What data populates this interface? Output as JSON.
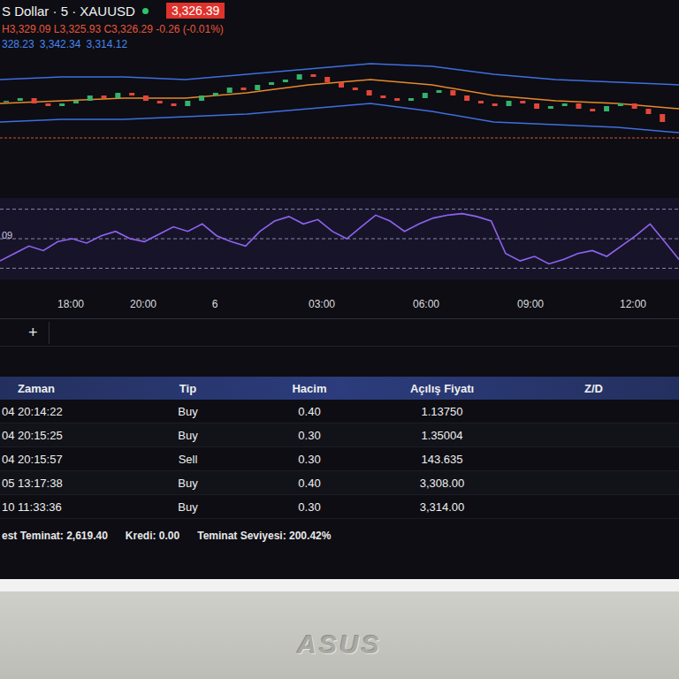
{
  "chart": {
    "symbol": "S Dollar · 5 · XAUUSD",
    "live": true,
    "price": "3,326.39",
    "ohlc": "H3,329.09 L3,325.93 C3,326.29 -0.26 (-0.01%)",
    "bands_values": [
      "328.23",
      "3,342.34",
      "3,314.12"
    ],
    "closes": [
      3328,
      3329,
      3327,
      3326,
      3327,
      3328,
      3330,
      3329,
      3331,
      3330,
      3328,
      3327,
      3326,
      3328,
      3330,
      3331,
      3333,
      3332,
      3334,
      3335,
      3336,
      3338,
      3337,
      3335,
      3333,
      3332,
      3330,
      3329,
      3328,
      3329,
      3331,
      3332,
      3330,
      3328,
      3327,
      3326,
      3328,
      3327,
      3325,
      3326,
      3327,
      3325,
      3324,
      3326,
      3327,
      3325,
      3323,
      3320
    ],
    "upper_band": [
      3336,
      3337,
      3337,
      3336,
      3338,
      3340,
      3342,
      3341,
      3338,
      3336,
      3335,
      3334
    ],
    "lower_band": [
      3320,
      3321,
      3321,
      3322,
      3323,
      3325,
      3327,
      3324,
      3320,
      3319,
      3318,
      3316
    ],
    "moving_average": [
      3327,
      3328,
      3329,
      3329,
      3331,
      3334,
      3336,
      3334,
      3330,
      3328,
      3327,
      3325
    ],
    "level_line": 3314
  },
  "rsi": {
    "label": "09",
    "values": [
      35,
      40,
      45,
      42,
      48,
      50,
      47,
      52,
      55,
      50,
      48,
      53,
      58,
      55,
      60,
      52,
      48,
      45,
      55,
      62,
      65,
      60,
      63,
      55,
      50,
      58,
      66,
      62,
      55,
      60,
      64,
      66,
      67,
      65,
      62,
      40,
      35,
      38,
      33,
      36,
      40,
      42,
      38,
      45,
      52,
      60,
      48,
      36
    ],
    "levels": [
      70,
      50,
      30
    ]
  },
  "time_axis": [
    "18:00",
    "20:00",
    "6",
    "03:00",
    "06:00",
    "09:00",
    "12:00"
  ],
  "tabs": [
    {
      "label": "+",
      "selected": false
    }
  ],
  "table": {
    "columns": [
      "Zaman",
      "Tip",
      "Hacim",
      "Açılış Fiyatı",
      "Z/D"
    ],
    "rows": [
      {
        "time": "04 20:14:22",
        "type": "Buy",
        "volume": "0.40",
        "open_price": "1.13750"
      },
      {
        "time": "04 20:15:25",
        "type": "Buy",
        "volume": "0.30",
        "open_price": "1.35004"
      },
      {
        "time": "04 20:15:57",
        "type": "Sell",
        "volume": "0.30",
        "open_price": "143.635"
      },
      {
        "time": "05 13:17:38",
        "type": "Buy",
        "volume": "0.40",
        "open_price": "3,308.00"
      },
      {
        "time": "10 11:33:36",
        "type": "Buy",
        "volume": "0.30",
        "open_price": "3,314.00"
      }
    ]
  },
  "status_bar": {
    "margin": "est Teminat: 2,619.40",
    "credit": "Kredi: 0.00",
    "margin_level": "Teminat Seviyesi: 200.42%"
  },
  "bezel": {
    "logo": "ASUS"
  }
}
